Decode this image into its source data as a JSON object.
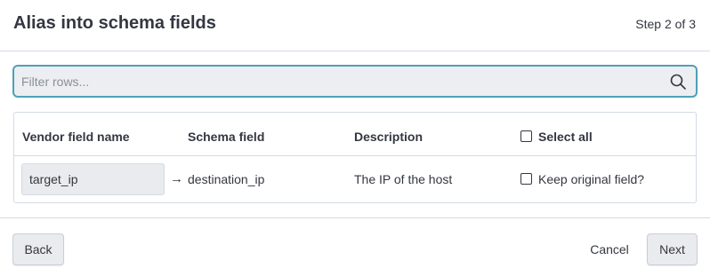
{
  "dialog": {
    "title": "Alias into schema fields",
    "step": "Step 2 of 3"
  },
  "filter": {
    "placeholder": "Filter rows...",
    "value": "",
    "icon": "search-icon"
  },
  "table": {
    "columns": {
      "vendor": "Vendor field name",
      "schema": "Schema field",
      "description": "Description",
      "select_all": "Select all"
    },
    "select_all_checked": false,
    "rows": [
      {
        "vendor_field": "target_ip",
        "arrow": "→",
        "schema_field": "destination_ip",
        "description": "The IP of the host",
        "keep_label": "Keep original field?",
        "keep_checked": false
      }
    ]
  },
  "footer": {
    "back_label": "Back",
    "cancel_label": "Cancel",
    "next_label": "Next"
  },
  "colors": {
    "accent_border": "#4fa0b8",
    "input_bg": "#eceef1",
    "divider": "#d3dae6",
    "text": "#343741"
  }
}
